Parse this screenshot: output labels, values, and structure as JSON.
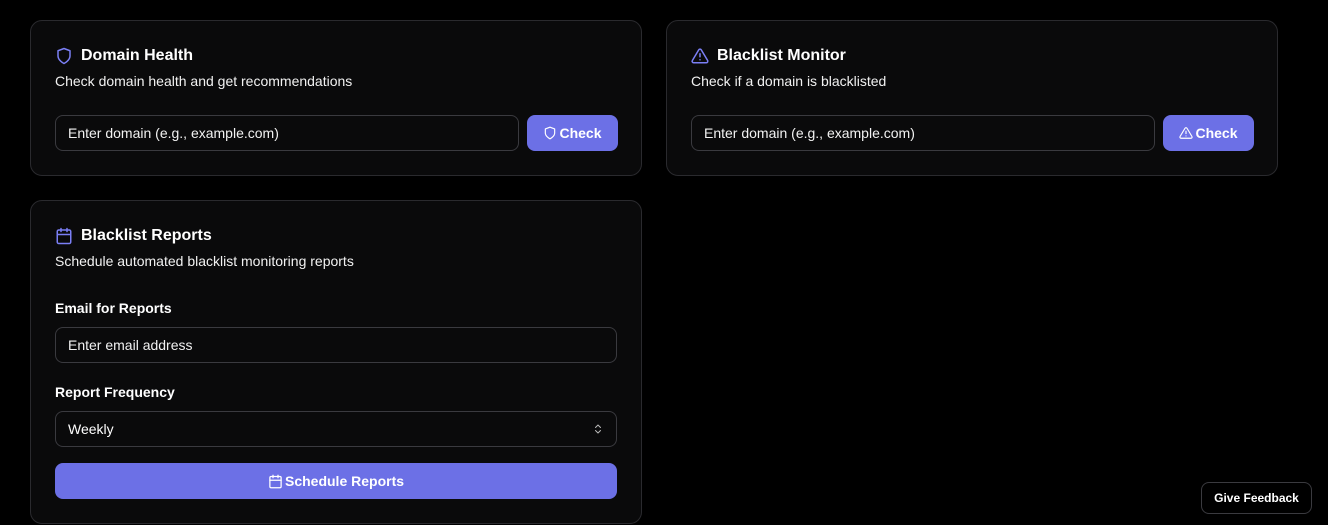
{
  "domain_health": {
    "icon": "shield-icon",
    "title": "Domain Health",
    "description": "Check domain health and get recommendations",
    "input_placeholder": "Enter domain (e.g., example.com)",
    "check_label": "Check",
    "check_icon": "shield-icon"
  },
  "blacklist_monitor": {
    "icon": "alert-triangle-icon",
    "title": "Blacklist Monitor",
    "description": "Check if a domain is blacklisted",
    "input_placeholder": "Enter domain (e.g., example.com)",
    "check_label": "Check",
    "check_icon": "alert-triangle-icon"
  },
  "blacklist_reports": {
    "icon": "calendar-icon",
    "title": "Blacklist Reports",
    "description": "Schedule automated blacklist monitoring reports",
    "email_label": "Email for Reports",
    "email_placeholder": "Enter email address",
    "frequency_label": "Report Frequency",
    "frequency_value": "Weekly",
    "schedule_label": "Schedule Reports",
    "schedule_icon": "calendar-icon"
  },
  "feedback": {
    "label": "Give Feedback"
  },
  "colors": {
    "accent": "#6c70e6",
    "icon_accent": "#7b7ff5",
    "background": "#000000",
    "card": "#0a0a0b",
    "border": "#2a2a2e"
  }
}
